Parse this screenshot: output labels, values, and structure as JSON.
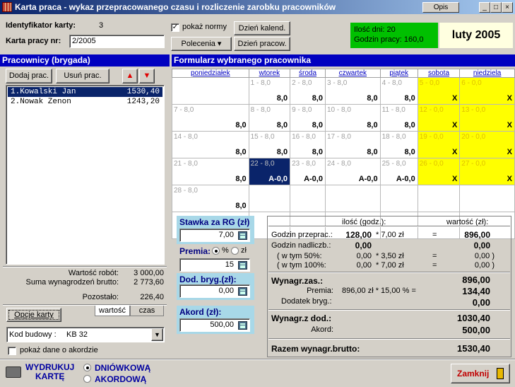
{
  "window": {
    "title": "Karta praca - wykaz przepracowanego czasu i rozliczenie zarobku pracowników",
    "opis_label": "Opis",
    "min": "_",
    "max": "□",
    "close": "×"
  },
  "header": {
    "id_label": "Identyfikator karty:",
    "id_value": "3",
    "nr_label": "Karta pracy nr:",
    "nr_value": "2/2005",
    "show_norms_label": "pokaż normy",
    "dzien_kalend": "Dzień kalend.",
    "polecenia": "Polecenia ▾",
    "dzien_pracow": "Dzień pracow.",
    "ilosc_dni": "Ilość dni: 20",
    "godzin_pracy": "Godzin pracy: 160,0",
    "period": "luty 2005"
  },
  "workers": {
    "title": "Pracownicy (brygada)",
    "add": "Dodaj prac.",
    "remove": "Usuń prac.",
    "items": [
      {
        "name": "1.Kowalski Jan",
        "amount": "1530,40"
      },
      {
        "name": "2.Nowak Zenon",
        "amount": "1243,20"
      }
    ],
    "wartosc_robot_label": "Wartość robót:",
    "wartosc_robot": "3 000,00",
    "suma_label": "Suma wynagrodzeń brutto:",
    "suma": "2 773,60",
    "pozostalo_label": "Pozostało:",
    "pozostalo": "226,40",
    "opcje": "Opcje karty",
    "tab_wartosc": "wartość",
    "tab_czas": "czas",
    "kod_label": "Kod budowy :",
    "kod_value": "KB 32",
    "akord_check": "pokaż dane o akordzie"
  },
  "form": {
    "title": "Formularz wybranego pracownika",
    "days": [
      "poniedziałek",
      "wtorek",
      "środa",
      "czwartek",
      "piątek",
      "sobota",
      "niedziela"
    ],
    "weeks": [
      [
        {
          "d": "",
          "h": ""
        },
        {
          "d": "1 - 8,0",
          "h": "8,0"
        },
        {
          "d": "2 - 8,0",
          "h": "8,0"
        },
        {
          "d": "3 - 8,0",
          "h": "8,0"
        },
        {
          "d": "4 - 8,0",
          "h": "8,0"
        },
        {
          "d": "5 - 0,0",
          "h": "X"
        },
        {
          "d": "6 - 0,0",
          "h": "X"
        }
      ],
      [
        {
          "d": "7 - 8,0",
          "h": "8,0"
        },
        {
          "d": "8 - 8,0",
          "h": "8,0"
        },
        {
          "d": "9 - 8,0",
          "h": "8,0"
        },
        {
          "d": "10 - 8,0",
          "h": "8,0"
        },
        {
          "d": "11 - 8,0",
          "h": "8,0"
        },
        {
          "d": "12 - 0,0",
          "h": "X"
        },
        {
          "d": "13 - 0,0",
          "h": "X"
        }
      ],
      [
        {
          "d": "14 - 8,0",
          "h": "8,0"
        },
        {
          "d": "15 - 8,0",
          "h": "8,0"
        },
        {
          "d": "16 - 8,0",
          "h": "8,0"
        },
        {
          "d": "17 - 8,0",
          "h": "8,0"
        },
        {
          "d": "18 - 8,0",
          "h": "8,0"
        },
        {
          "d": "19 - 0,0",
          "h": "X"
        },
        {
          "d": "20 - 0,0",
          "h": "X"
        }
      ],
      [
        {
          "d": "21 - 8,0",
          "h": "8,0"
        },
        {
          "d": "22 - 8,0",
          "h": "A-0,0"
        },
        {
          "d": "23 - 8,0",
          "h": "A-0,0"
        },
        {
          "d": "24 - 8,0",
          "h": "A-0,0"
        },
        {
          "d": "25 - 8,0",
          "h": "A-0,0"
        },
        {
          "d": "26 - 0,0",
          "h": "X"
        },
        {
          "d": "27 - 0,0",
          "h": "X"
        }
      ],
      [
        {
          "d": "28 - 8,0",
          "h": "8,0"
        },
        {
          "d": "",
          "h": ""
        },
        {
          "d": "",
          "h": ""
        },
        {
          "d": "",
          "h": ""
        },
        {
          "d": "",
          "h": ""
        },
        {
          "d": "",
          "h": ""
        },
        {
          "d": "",
          "h": ""
        }
      ],
      [
        {
          "d": "",
          "h": ""
        },
        {
          "d": "",
          "h": ""
        },
        {
          "d": "",
          "h": ""
        },
        {
          "d": "",
          "h": ""
        },
        {
          "d": "",
          "h": ""
        },
        {
          "d": "",
          "h": ""
        },
        {
          "d": "",
          "h": ""
        }
      ]
    ]
  },
  "rates": {
    "stawka_label": "Stawka za RG (zł)",
    "stawka": "7,00",
    "premia_label": "Premia:",
    "premia_pct": "%",
    "premia_zl": "zł",
    "premia": "15",
    "dod_label": "Dod. bryg.(zł):",
    "dod": "0,00",
    "akord_label": "Akord (zł):",
    "akord": "500,00"
  },
  "summary": {
    "ilosc_hdr": "ilość (godz.):",
    "wartosc_hdr": "wartość (zł):",
    "godz_przeprac": "Godzin przeprac.:",
    "godz_przeprac_q": "128,00",
    "godz_przeprac_r": "* 7,00 zł",
    "godz_przeprac_eq": "=",
    "godz_przeprac_v": "896,00",
    "godz_nadl": "Godzin nadliczb.:",
    "godz_nadl_q": "0,00",
    "godz_nadl_v": "0,00",
    "w50": "( w tym 50%:",
    "w50_q": "0,00",
    "w50_r": "* 3,50 zł",
    "w50_eq": "=",
    "w50_v": "0,00 )",
    "w100": "( w tym 100%:",
    "w100_q": "0,00",
    "w100_r": "* 7,00 zł",
    "w100_eq": "=",
    "w100_v": "0,00 )",
    "wyn_zas": "Wynagr.zas.:",
    "wyn_zas_v": "896,00",
    "premia": "Premia:",
    "premia_calc": "896,00 zł  *  15,00 %  =",
    "premia_v": "134,40",
    "dod_bryg": "Dodatek bryg.:",
    "dod_bryg_v": "0,00",
    "wyn_dod": "Wynagr.z dod.:",
    "wyn_dod_v": "1030,40",
    "akord": "Akord:",
    "akord_v": "500,00",
    "razem": "Razem wynagr.brutto:",
    "razem_v": "1530,40"
  },
  "footer": {
    "print1": "WYDRUKUJ",
    "print2": "KARTĘ",
    "opt1": "DNIÓWKOWĄ",
    "opt2": "AKORDOWĄ",
    "close": "Zamknij"
  }
}
